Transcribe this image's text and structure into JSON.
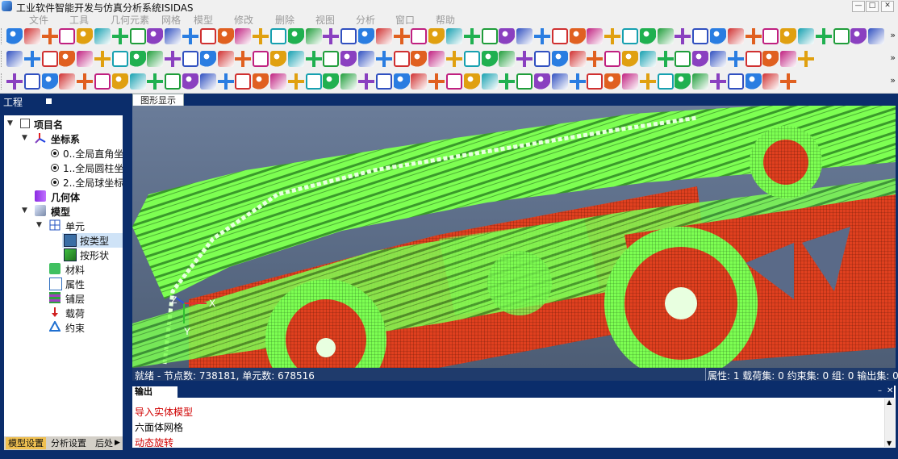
{
  "window": {
    "title": "工业软件智能开发与仿真分析系统ISIDAS",
    "min_label": "—",
    "max_label": "□",
    "close_label": "✕"
  },
  "menu": [
    "文件",
    "工具",
    "几何元素",
    "网格",
    "模型",
    "修改",
    "删除",
    "视图",
    "分析",
    "窗口",
    "帮助"
  ],
  "toolbar_more": "»",
  "left_panel": {
    "title": "工程"
  },
  "tree": {
    "root": "项目名",
    "coord_sys": "坐标系",
    "coord_items": [
      "0..全局直角坐",
      "1..全局圆柱坐",
      "2..全局球坐标"
    ],
    "geometry": "几何体",
    "model": "模型",
    "element": "单元",
    "by_type": "按类型",
    "by_shape": "按形状",
    "material": "材料",
    "property": "属性",
    "layup": "铺层",
    "load": "载荷",
    "constraint": "约束"
  },
  "bottom_tabs": [
    "模型设置",
    "分析设置",
    "后处"
  ],
  "view_tab": "图形显示",
  "axis_labels": {
    "x": "X",
    "y": "Y",
    "z": "Z"
  },
  "status": {
    "left": "就绪 - 节点数: 738181, 单元数: 678516",
    "right": "属性: 1   载荷集: 0   约束集: 0   组: 0   输出集: 0"
  },
  "output": {
    "title": "输出",
    "lines": [
      {
        "text": "导入实体模型",
        "color": "#d00000"
      },
      {
        "text": "六面体网格",
        "color": "#000000"
      },
      {
        "text": "动态旋转",
        "color": "#d00000"
      }
    ]
  },
  "colors": {
    "mesh_green": "#7dff52",
    "mesh_red": "#e0401f",
    "background": "#0b2d6b"
  }
}
